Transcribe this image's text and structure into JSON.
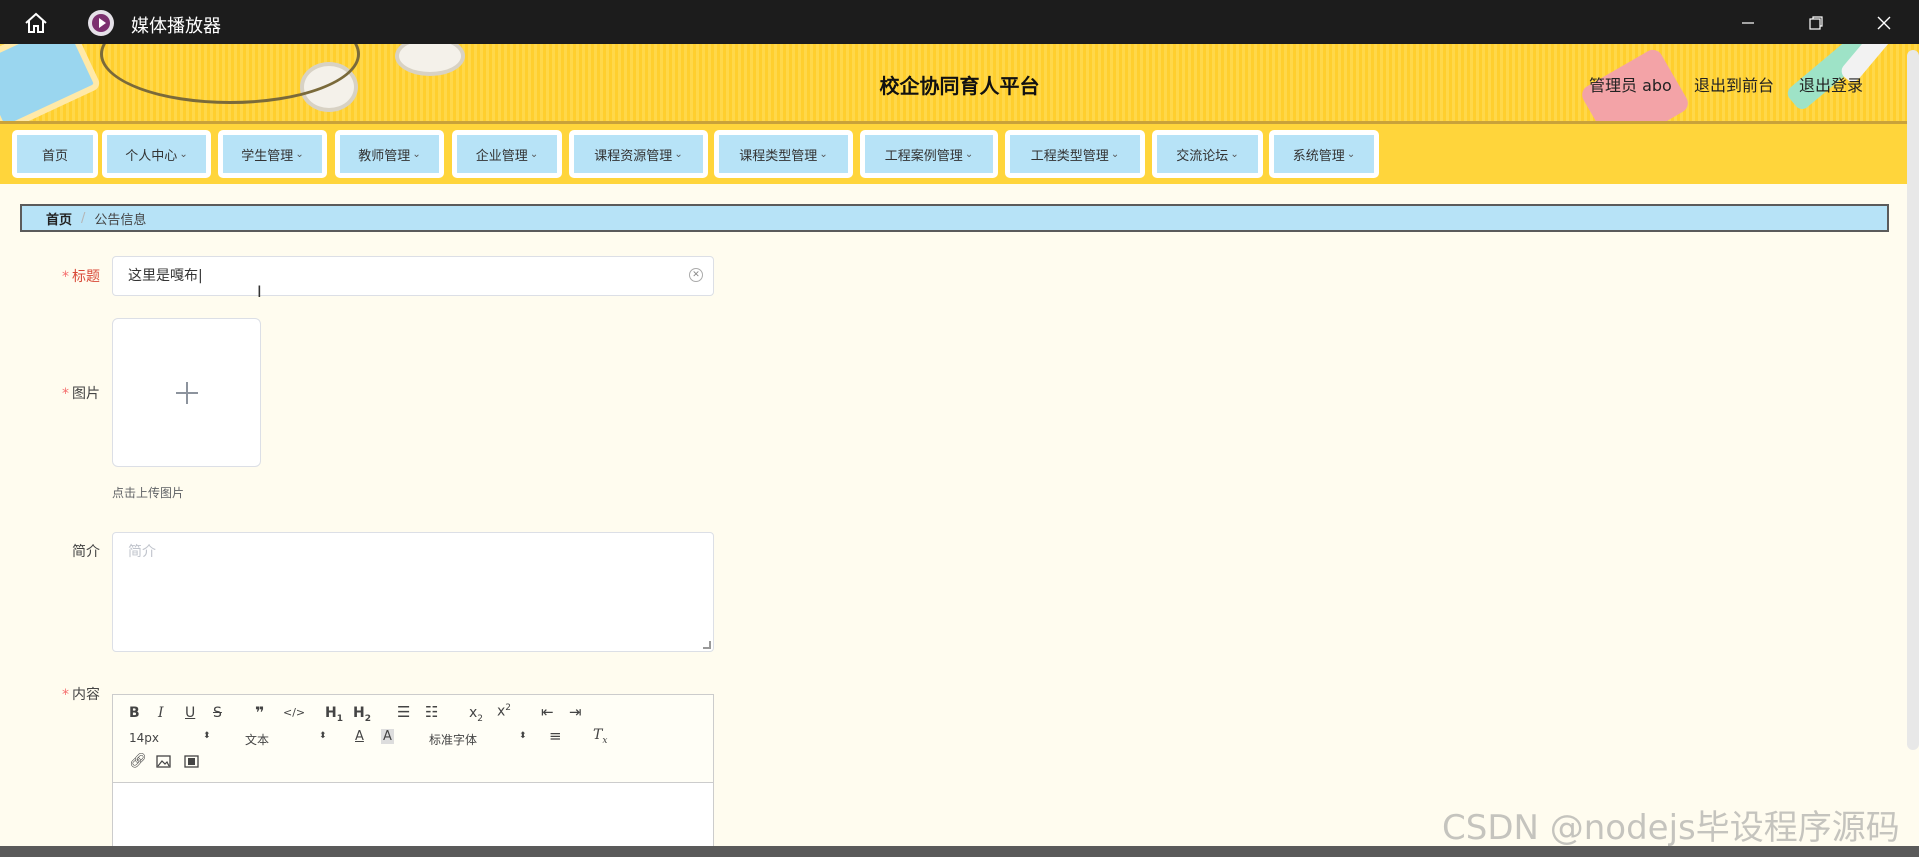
{
  "window": {
    "title": "媒体播放器",
    "home_icon": "home-icon",
    "app_icon": "media-player-icon",
    "minimize_label": "—",
    "maximize_label": "❐",
    "close_label": "✕"
  },
  "header": {
    "site_title": "校企协同育人平台",
    "user_label": "管理员 abo",
    "front_link": "退出到前台",
    "logout_link": "退出登录"
  },
  "nav": {
    "items": [
      {
        "label": "首页",
        "has_dropdown": false
      },
      {
        "label": "个人中心",
        "has_dropdown": true
      },
      {
        "label": "学生管理",
        "has_dropdown": true
      },
      {
        "label": "教师管理",
        "has_dropdown": true
      },
      {
        "label": "企业管理",
        "has_dropdown": true
      },
      {
        "label": "课程资源管理",
        "has_dropdown": true
      },
      {
        "label": "课程类型管理",
        "has_dropdown": true
      },
      {
        "label": "工程案例管理",
        "has_dropdown": true
      },
      {
        "label": "工程类型管理",
        "has_dropdown": true
      },
      {
        "label": "交流论坛",
        "has_dropdown": true
      },
      {
        "label": "系统管理",
        "has_dropdown": true
      }
    ]
  },
  "breadcrumb": {
    "home": "首页",
    "separator": "/",
    "current": "公告信息"
  },
  "form": {
    "title_label": "标题",
    "title_value": "这里是嘎布|",
    "image_label": "图片",
    "upload_tip": "点击上传图片",
    "intro_label": "简介",
    "intro_placeholder": "简介",
    "content_label": "内容",
    "required_mark": "*"
  },
  "editor": {
    "font_size": "14px",
    "header_select": "文本",
    "font_family": "标准字体"
  },
  "watermark": "CSDN @nodejs毕设程序源码",
  "colors": {
    "nav_bg": "#ffd53b",
    "nav_item_bg": "#b7e3f7",
    "page_bg": "#fffcef",
    "required": "#f56c6c"
  }
}
